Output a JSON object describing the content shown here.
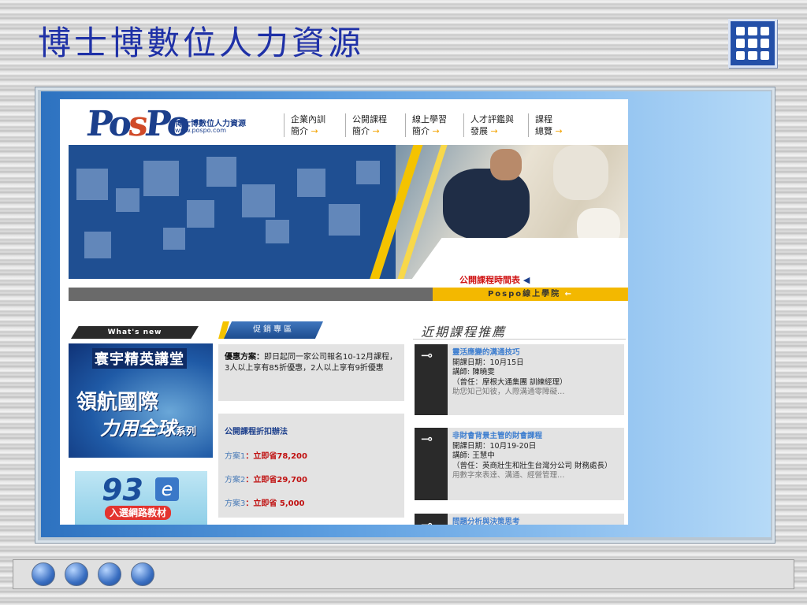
{
  "slide": {
    "title": "博士博數位人力資源"
  },
  "header": {
    "logo_left": "Po",
    "logo_mid": "s",
    "logo_right": "Po",
    "brand_name": "博士博數位人力資源",
    "brand_url": "www.pospo.com",
    "nav": [
      {
        "line1": "企業內訓",
        "line2": "簡介"
      },
      {
        "line1": "公開課程",
        "line2": "簡介"
      },
      {
        "line1": "線上學習",
        "line2": "簡介"
      },
      {
        "line1": "人才評鑑與",
        "line2": "發展"
      },
      {
        "line1": "課程",
        "line2": "總覽"
      }
    ],
    "nav_arrow": "→"
  },
  "banner": {
    "schedule_link": "公開課程時間表",
    "schedule_arrow": "◀",
    "academy": "Pospo線上學院",
    "academy_arrow": "←"
  },
  "left": {
    "whats_new": "What's new",
    "ad1_top": "寰宇精英講堂",
    "ad1_mid": "領航國際",
    "ad1_bot": "力用全球",
    "ad1_series": "系列",
    "ad2_num": "93",
    "ad2_e": "e",
    "ad2_label": "入選網路教材"
  },
  "promo": {
    "tab": "促銷專區",
    "offer_label": "優惠方案：",
    "offer_text": "即日起同一家公司報名10-12月課程，3人以上享有85折優惠，2人以上享有9折優惠",
    "discount_title": "公開課程折扣辦法",
    "plans": [
      {
        "name": "方案1",
        "sep": "：",
        "save": "立即省78,200"
      },
      {
        "name": "方案2",
        "sep": "：",
        "save": "立即省29,700"
      },
      {
        "name": "方案3",
        "sep": "：",
        "save": "立即省 5,000"
      }
    ]
  },
  "recent": {
    "title": "近期課程推薦",
    "courses": [
      {
        "name": "靈活應變的溝通技巧",
        "date": "開課日期：10月15日",
        "lecturer": "講師: 陳曉雯",
        "bio": "（曾任：摩根大通集團 訓練經理）",
        "teaser": "助您知己知彼，人際溝通零障礙…"
      },
      {
        "name": "非財會背景主管的財會課程",
        "date": "開課日期：10月19-20日",
        "lecturer": "講師: 王慧中",
        "bio": "（曾任：英商壯生和壯生台灣分公司 財務處長）",
        "teaser": "用數字來表達、溝通、經營管理…"
      },
      {
        "name": "問題分析與決策思考"
      }
    ]
  },
  "colors": {
    "title_blue": "#1f31a7",
    "gold": "#f3b800",
    "promo_grey": "#e3e3e3",
    "link_red": "#d01414",
    "course_blue": "#3f7fd0"
  }
}
